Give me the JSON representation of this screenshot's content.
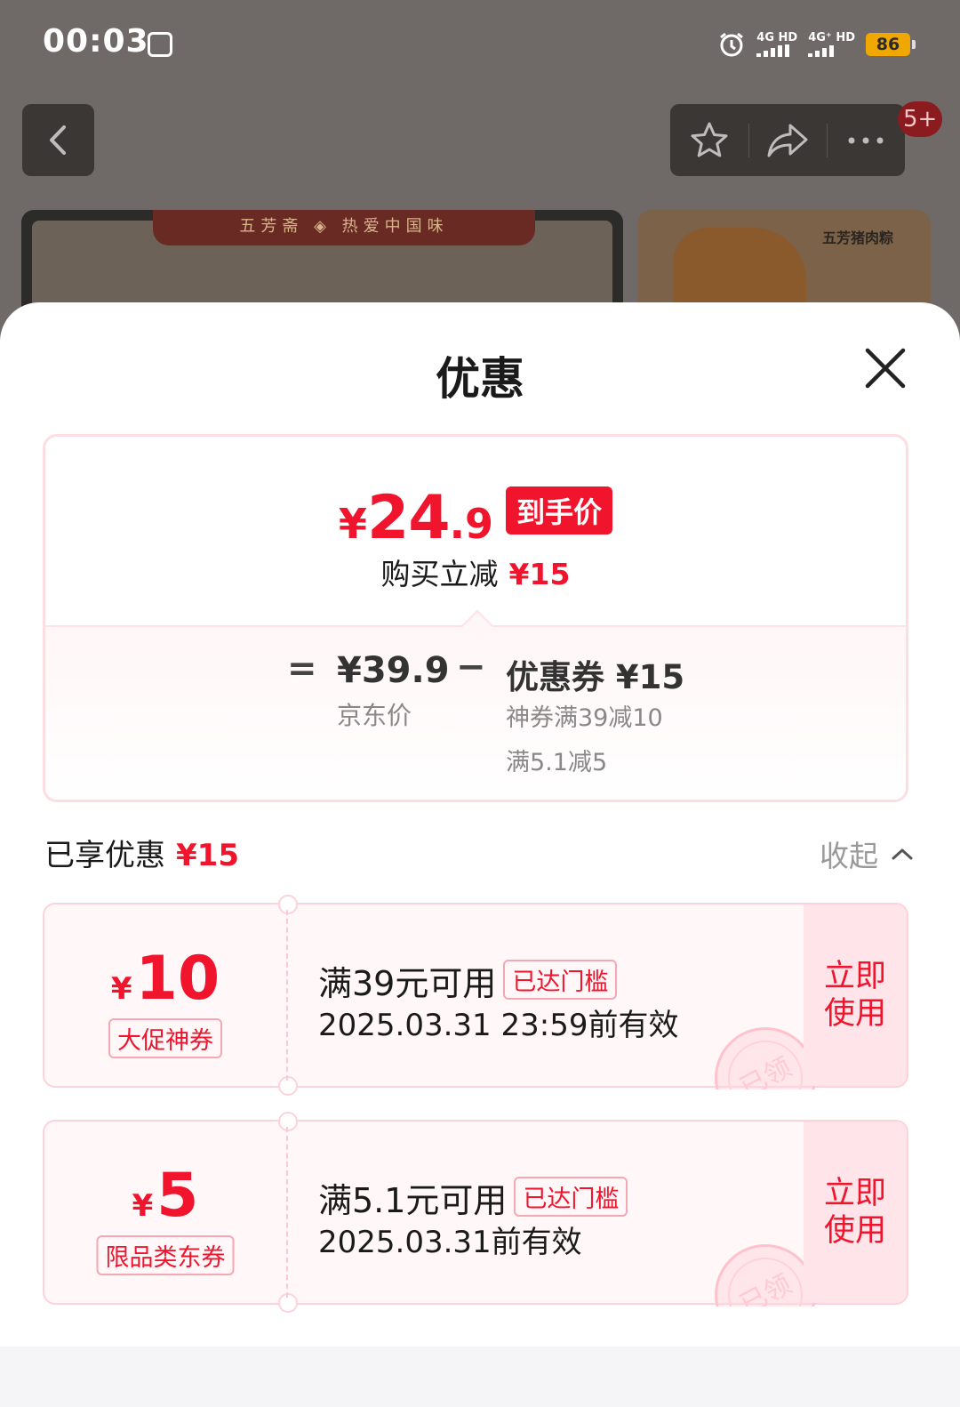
{
  "status_bar": {
    "time": "00:03",
    "network_1": "4G HD",
    "network_2": "4G⁺ HD",
    "battery": "86",
    "icons": [
      "app-icon",
      "alarm-icon",
      "signal-icon",
      "battery-icon"
    ]
  },
  "nav": {
    "badge": "5+",
    "icons": [
      "back-icon",
      "star-icon",
      "share-icon",
      "more-icon"
    ]
  },
  "banner": {
    "main_tag": "五芳斋 ◈ 热爱中国味",
    "side_title": "五芳猪肉粽"
  },
  "sheet": {
    "title": "优惠",
    "price": {
      "currency": "¥",
      "integer": "24",
      "decimal": ".9",
      "tag": "到手价",
      "saving_label": "购买立减",
      "saving_amount": "¥15"
    },
    "breakdown": {
      "equals": "=",
      "jd_price": "¥39.9",
      "jd_label": "京东价",
      "minus": "−",
      "coupon_total": "优惠券 ¥15",
      "coupon_detail_1": "神券满39减10",
      "coupon_detail_2": "满5.1减5"
    },
    "enjoyed": {
      "label": "已享优惠",
      "amount": "¥15",
      "collapse": "收起"
    },
    "coupons": [
      {
        "currency": "¥",
        "amount": "10",
        "type": "大促神券",
        "condition": "满39元可用",
        "tag": "已达门槛",
        "validity": "2025.03.31 23:59前有效",
        "action": "立即使用",
        "stamp": "已领"
      },
      {
        "currency": "¥",
        "amount": "5",
        "type": "限品类东券",
        "condition": "满5.1元可用",
        "tag": "已达门槛",
        "validity": "2025.03.31前有效",
        "action": "立即使用",
        "stamp": "已领"
      }
    ]
  },
  "colors": {
    "accent": "#f0142d",
    "overlay": "#6f6a68",
    "coupon_bg": "#fff7f8"
  }
}
